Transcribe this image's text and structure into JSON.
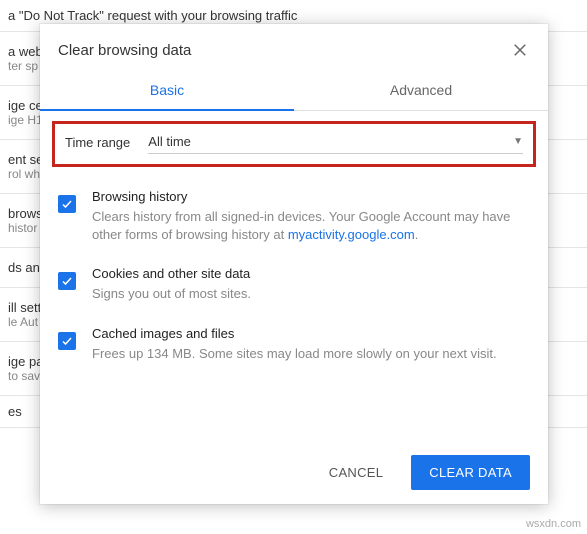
{
  "background": {
    "row1": "a \"Do Not Track\" request with your browsing traffic",
    "row2t": "a web s",
    "row2s": "ter sp",
    "row3t": "ige ce",
    "row3s": "ige H1",
    "row4t": "ent set",
    "row4s": "rol wh",
    "row5t": "brows",
    "row5s": "histor",
    "row6t": "ds anc",
    "row7t": "ill sett",
    "row7s": "le Aut",
    "row8t": "ige pa",
    "row8s": "to sav",
    "row9t": "es"
  },
  "dialog": {
    "title": "Clear browsing data",
    "tabs": {
      "basic": "Basic",
      "advanced": "Advanced"
    },
    "timerange": {
      "label": "Time range",
      "value": "All time"
    },
    "items": [
      {
        "title": "Browsing history",
        "desc1": "Clears history from all signed-in devices. Your Google Account may have other forms of browsing history at ",
        "link": "myactivity.google.com",
        "desc2": "."
      },
      {
        "title": "Cookies and other site data",
        "desc1": "Signs you out of most sites."
      },
      {
        "title": "Cached images and files",
        "desc1": "Frees up 134 MB. Some sites may load more slowly on your next visit."
      }
    ],
    "actions": {
      "cancel": "CANCEL",
      "clear": "CLEAR DATA"
    }
  },
  "watermark": "wsxdn.com"
}
